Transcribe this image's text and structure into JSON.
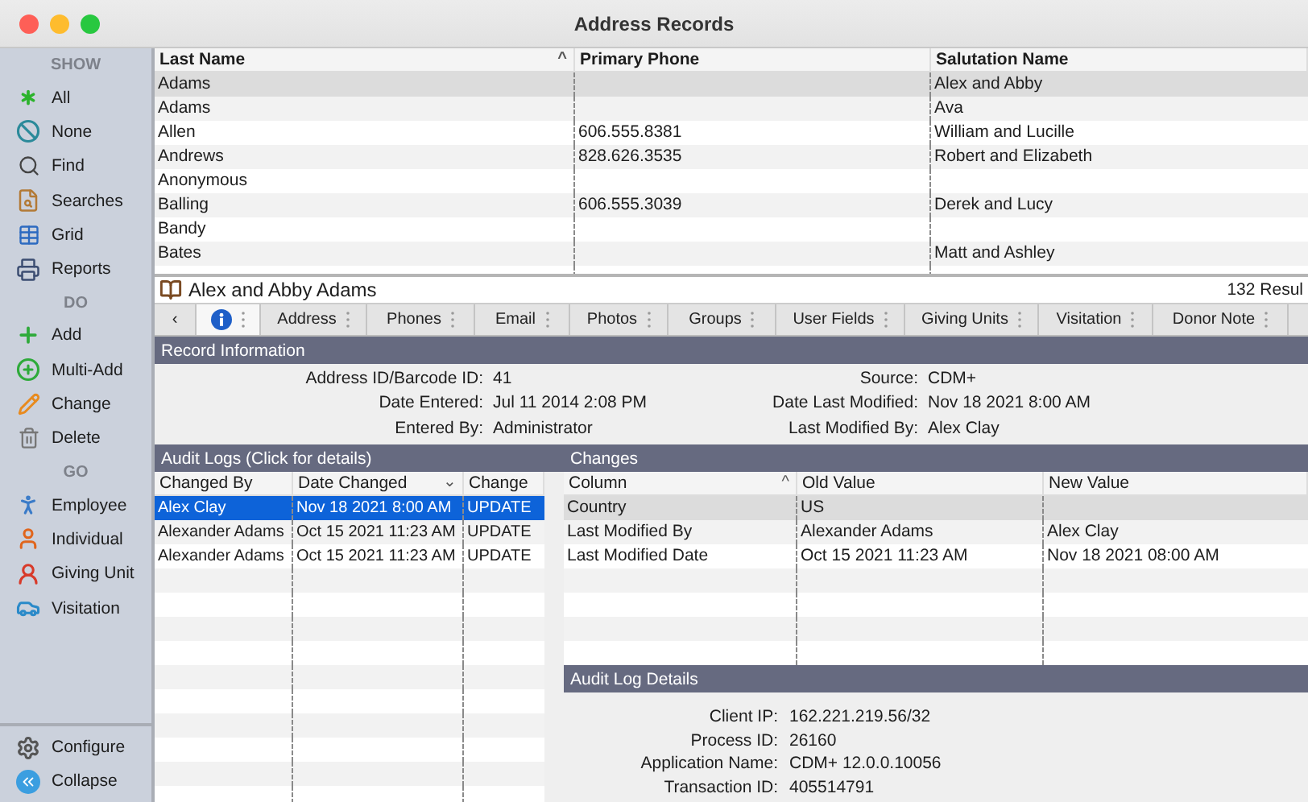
{
  "window": {
    "title": "Address Records"
  },
  "sidebar": {
    "sections": [
      {
        "heading": "SHOW",
        "items": [
          {
            "label": "All"
          },
          {
            "label": "None"
          },
          {
            "label": "Find"
          },
          {
            "label": "Searches"
          },
          {
            "label": "Grid"
          },
          {
            "label": "Reports"
          }
        ]
      },
      {
        "heading": "DO",
        "items": [
          {
            "label": "Add"
          },
          {
            "label": "Multi-Add"
          },
          {
            "label": "Change"
          },
          {
            "label": "Delete"
          }
        ]
      },
      {
        "heading": "GO",
        "items": [
          {
            "label": "Employee"
          },
          {
            "label": "Individual"
          },
          {
            "label": "Giving Unit"
          },
          {
            "label": "Visitation"
          }
        ]
      }
    ],
    "footer": [
      {
        "label": "Configure"
      },
      {
        "label": "Collapse"
      }
    ]
  },
  "records_table": {
    "columns": [
      {
        "label": "Last Name",
        "sort_indicator": "^"
      },
      {
        "label": "Primary Phone"
      },
      {
        "label": "Salutation Name"
      }
    ],
    "rows": [
      {
        "last_name": "Adams",
        "salutation_name": "Alex and Abby",
        "selected": true
      },
      {
        "last_name": "Adams",
        "salutation_name": "Ava",
        "selected": false
      },
      {
        "last_name": "Allen",
        "primary_phone": "606.555.8381",
        "salutation_name": "William and Lucille",
        "selected": false
      },
      {
        "last_name": "Andrews",
        "primary_phone": "828.626.3535",
        "salutation_name": "Robert and Elizabeth",
        "selected": false
      },
      {
        "last_name": "Anonymous",
        "selected": false
      },
      {
        "last_name": "Balling",
        "primary_phone": "606.555.3039",
        "salutation_name": "Derek and Lucy",
        "selected": false
      },
      {
        "last_name": "Bandy",
        "selected": false
      },
      {
        "last_name": "Bates",
        "salutation_name": "Matt and Ashley",
        "selected": false
      }
    ]
  },
  "record_bar": {
    "name": "Alex and Abby Adams",
    "result_count": "132 Resul"
  },
  "tabs": [
    {
      "kind": "back",
      "label": "‹",
      "selected": false
    },
    {
      "kind": "info",
      "selected": true
    },
    {
      "kind": "label",
      "label": "Address",
      "selected": false
    },
    {
      "kind": "label",
      "label": "Phones",
      "selected": false
    },
    {
      "kind": "label",
      "label": "Email",
      "selected": false
    },
    {
      "kind": "label",
      "label": "Photos",
      "selected": false
    },
    {
      "kind": "label",
      "label": "Groups",
      "selected": false
    },
    {
      "kind": "label",
      "label": "User Fields",
      "selected": false
    },
    {
      "kind": "label",
      "label": "Giving Units",
      "selected": false
    },
    {
      "kind": "label",
      "label": "Visitation",
      "selected": false
    },
    {
      "kind": "label",
      "label": "Donor Note",
      "selected": false
    }
  ],
  "record_information": {
    "title": "Record Information",
    "left": [
      {
        "label": "Address ID/Barcode ID:",
        "value": "41"
      },
      {
        "label": "Date Entered:",
        "value": "Jul 11 2014 2:08 PM"
      },
      {
        "label": "Entered By:",
        "value": "Administrator"
      }
    ],
    "right": [
      {
        "label": "Source:",
        "value": "CDM+"
      },
      {
        "label": "Date Last Modified:",
        "value": "Nov 18 2021 8:00 AM"
      },
      {
        "label": "Last Modified By:",
        "value": "Alex Clay"
      }
    ]
  },
  "audit_logs": {
    "title": "Audit Logs (Click for details)",
    "columns": [
      {
        "label": "Changed By"
      },
      {
        "label": "Date Changed",
        "sort_indicator": "⌄"
      },
      {
        "label": "Change"
      }
    ],
    "rows": [
      {
        "cells": [
          "Alex Clay",
          "Nov 18 2021 8:00 AM",
          "UPDATE"
        ],
        "selected": true
      },
      {
        "cells": [
          "Alexander Adams",
          "Oct 15 2021 11:23 AM",
          "UPDATE"
        ],
        "selected": false
      },
      {
        "cells": [
          "Alexander Adams",
          "Oct 15 2021 11:23 AM",
          "UPDATE"
        ],
        "selected": false
      }
    ]
  },
  "changes": {
    "title": "Changes",
    "columns": [
      {
        "label": "Column",
        "sort_indicator": "^"
      },
      {
        "label": "Old Value"
      },
      {
        "label": "New Value"
      }
    ],
    "rows": [
      {
        "cells": [
          "Country",
          "US",
          null
        ],
        "selected": true
      },
      {
        "cells": [
          "Last Modified By",
          "Alexander Adams",
          "Alex Clay"
        ],
        "selected": false
      },
      {
        "cells": [
          "Last Modified Date",
          "Oct 15 2021 11:23 AM",
          "Nov 18 2021 08:00 AM"
        ],
        "selected": false
      }
    ]
  },
  "audit_log_details": {
    "title": "Audit Log Details",
    "fields": [
      {
        "label": "Client IP:",
        "value": "162.221.219.56/32"
      },
      {
        "label": "Process ID:",
        "value": "26160"
      },
      {
        "label": "Application Name:",
        "value": "CDM+ 12.0.0.10056"
      },
      {
        "label": "Transaction ID:",
        "value": "405514791"
      }
    ]
  }
}
